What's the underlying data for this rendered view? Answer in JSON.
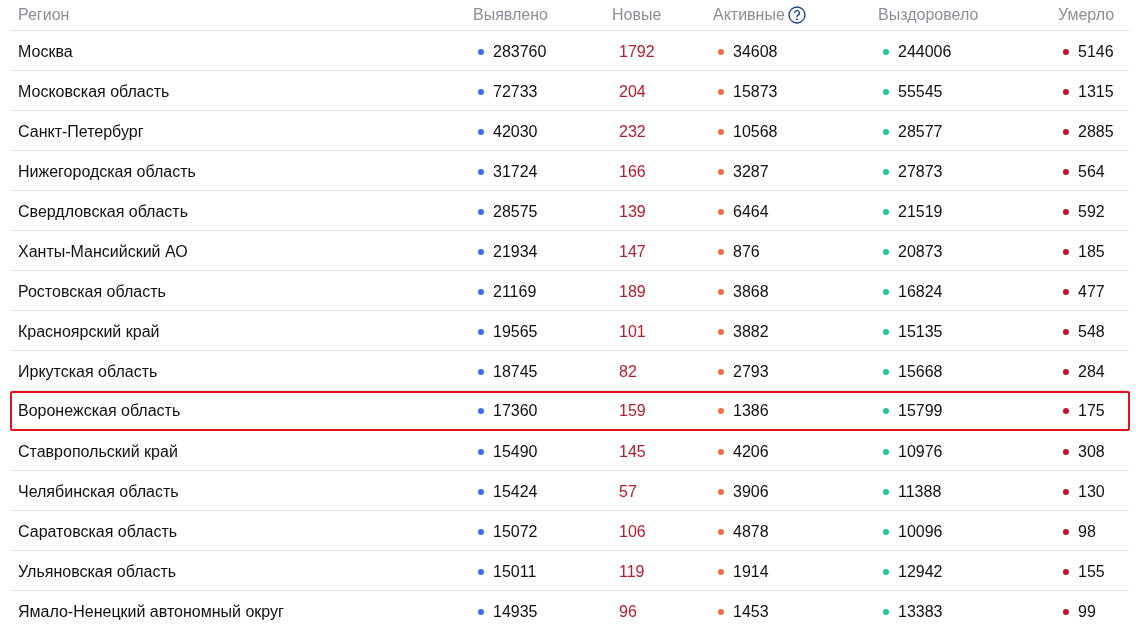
{
  "columns": [
    {
      "label": "Регион",
      "kind": "name",
      "help": false
    },
    {
      "label": "Выявлено",
      "kind": "dot",
      "color": "#3d6ef0",
      "help": false
    },
    {
      "label": "Новые",
      "kind": "text",
      "color": "#b71c2c",
      "help": false
    },
    {
      "label": "Активные",
      "kind": "dot",
      "color": "#f0703c",
      "help": true
    },
    {
      "label": "Выздоровело",
      "kind": "dot",
      "color": "#1fc49a",
      "help": false
    },
    {
      "label": "Умерло",
      "kind": "dot",
      "color": "#c8102e",
      "help": false
    }
  ],
  "rows": [
    {
      "region": "Москва",
      "values": [
        "283760",
        "1792",
        "34608",
        "244006",
        "5146"
      ],
      "highlighted": false
    },
    {
      "region": "Московская область",
      "values": [
        "72733",
        "204",
        "15873",
        "55545",
        "1315"
      ],
      "highlighted": false
    },
    {
      "region": "Санкт-Петербург",
      "values": [
        "42030",
        "232",
        "10568",
        "28577",
        "2885"
      ],
      "highlighted": false
    },
    {
      "region": "Нижегородская область",
      "values": [
        "31724",
        "166",
        "3287",
        "27873",
        "564"
      ],
      "highlighted": false
    },
    {
      "region": "Свердловская область",
      "values": [
        "28575",
        "139",
        "6464",
        "21519",
        "592"
      ],
      "highlighted": false
    },
    {
      "region": "Ханты-Мансийский АО",
      "values": [
        "21934",
        "147",
        "876",
        "20873",
        "185"
      ],
      "highlighted": false
    },
    {
      "region": "Ростовская область",
      "values": [
        "21169",
        "189",
        "3868",
        "16824",
        "477"
      ],
      "highlighted": false
    },
    {
      "region": "Красноярский край",
      "values": [
        "19565",
        "101",
        "3882",
        "15135",
        "548"
      ],
      "highlighted": false
    },
    {
      "region": "Иркутская область",
      "values": [
        "18745",
        "82",
        "2793",
        "15668",
        "284"
      ],
      "highlighted": false
    },
    {
      "region": "Воронежская область",
      "values": [
        "17360",
        "159",
        "1386",
        "15799",
        "175"
      ],
      "highlighted": true
    },
    {
      "region": "Ставропольский край",
      "values": [
        "15490",
        "145",
        "4206",
        "10976",
        "308"
      ],
      "highlighted": false
    },
    {
      "region": "Челябинская область",
      "values": [
        "15424",
        "57",
        "3906",
        "11388",
        "130"
      ],
      "highlighted": false
    },
    {
      "region": "Саратовская область",
      "values": [
        "15072",
        "106",
        "4878",
        "10096",
        "98"
      ],
      "highlighted": false
    },
    {
      "region": "Ульяновская область",
      "values": [
        "15011",
        "119",
        "1914",
        "12942",
        "155"
      ],
      "highlighted": false
    },
    {
      "region": "Ямало-Ненецкий автономный округ",
      "values": [
        "14935",
        "96",
        "1453",
        "13383",
        "99"
      ],
      "highlighted": false
    }
  ]
}
